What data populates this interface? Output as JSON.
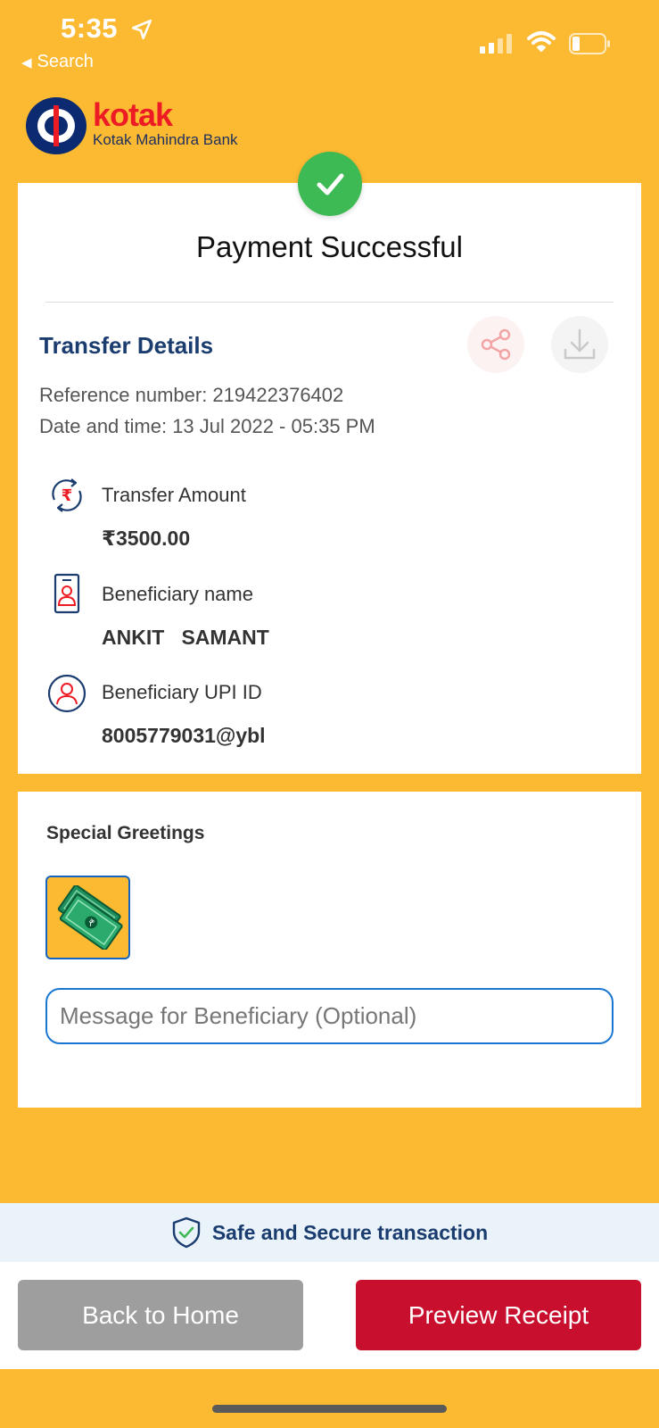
{
  "status_bar": {
    "time": "5:35",
    "back_label": "Search"
  },
  "brand": {
    "name": "kotak",
    "subtitle": "Kotak Mahindra Bank"
  },
  "payment": {
    "title": "Payment Successful"
  },
  "transfer": {
    "section_title": "Transfer Details",
    "reference": "Reference number: 219422376402",
    "datetime": "Date and time: 13 Jul 2022 - 05:35 PM",
    "rows": [
      {
        "label": "Transfer Amount",
        "value": "₹3500.00",
        "icon": "rupee-transfer-icon"
      },
      {
        "label": "Beneficiary name",
        "value": "ANKIT   SAMANT",
        "icon": "id-card-icon"
      },
      {
        "label": "Beneficiary UPI ID",
        "value": "8005779031@ybl",
        "icon": "user-circle-icon"
      }
    ]
  },
  "greetings": {
    "title": "Special Greetings",
    "message_placeholder": "Message for Beneficiary (Optional)"
  },
  "secure": {
    "text": "Safe and Secure transaction"
  },
  "actions": {
    "home_label": "Back to Home",
    "receipt_label": "Preview Receipt"
  },
  "colors": {
    "background": "#FCBA33",
    "brand_red": "#ED1C24",
    "navy": "#1a3c6e",
    "success_green": "#3DBA54",
    "receipt_button": "#C8102E",
    "home_button": "#9E9E9E"
  }
}
